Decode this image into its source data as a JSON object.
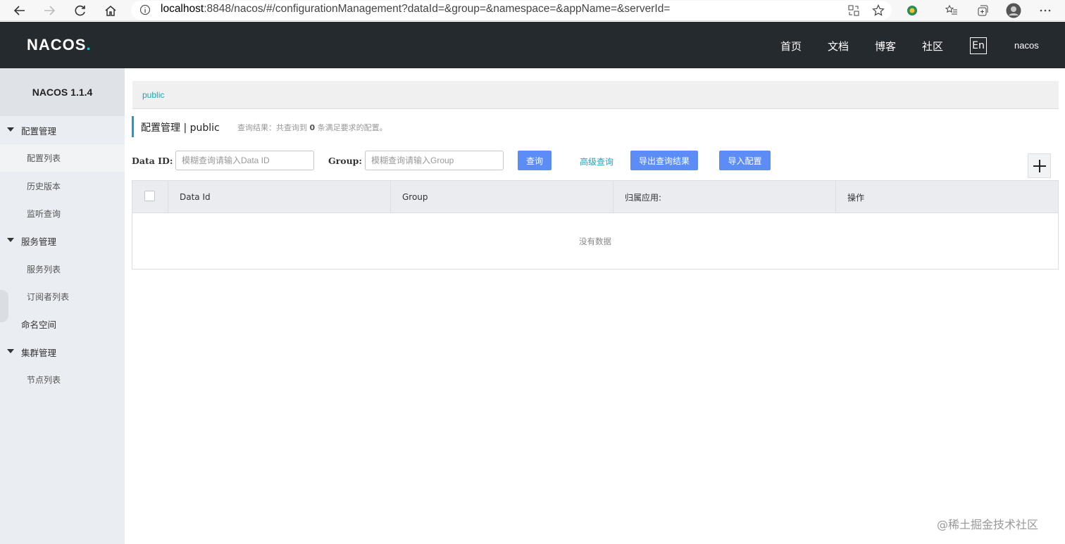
{
  "browser": {
    "url_host": "localhost",
    "url_rest": ":8848/nacos/#/configurationManagement?dataId=&group=&namespace=&appName=&serverId="
  },
  "header": {
    "logo_text": "NACOS",
    "logo_dot": ".",
    "nav": [
      "首页",
      "文档",
      "博客",
      "社区"
    ],
    "lang": "En",
    "user": "nacos"
  },
  "sidebar": {
    "title": "NACOS 1.1.4",
    "groups": [
      {
        "label": "配置管理",
        "items": [
          "配置列表",
          "历史版本",
          "监听查询"
        ]
      },
      {
        "label": "服务管理",
        "items": [
          "服务列表",
          "订阅者列表"
        ]
      },
      {
        "label": "命名空间"
      },
      {
        "label": "集群管理",
        "items": [
          "节点列表"
        ]
      }
    ]
  },
  "main": {
    "namespace": "public",
    "title": "配置管理  |  public",
    "result_prefix": "查询结果：共查询到 ",
    "result_count": "0",
    "result_suffix": " 条满足要求的配置。",
    "filters": {
      "data_id_label": "Data ID:",
      "data_id_placeholder": "模糊查询请输入Data ID",
      "group_label": "Group:",
      "group_placeholder": "模糊查询请输入Group"
    },
    "buttons": {
      "query": "查询",
      "advanced": "高级查询",
      "export": "导出查询结果",
      "import": "导入配置"
    },
    "table": {
      "columns": [
        "Data Id",
        "Group",
        "归属应用:",
        "操作"
      ],
      "empty_text": "没有数据"
    }
  },
  "watermark": "@稀土掘金技术社区",
  "colors": {
    "topbar": "#252a2f",
    "accent": "#1fa3b8",
    "button": "#5c8df6",
    "sidebar": "#eaedf1"
  }
}
